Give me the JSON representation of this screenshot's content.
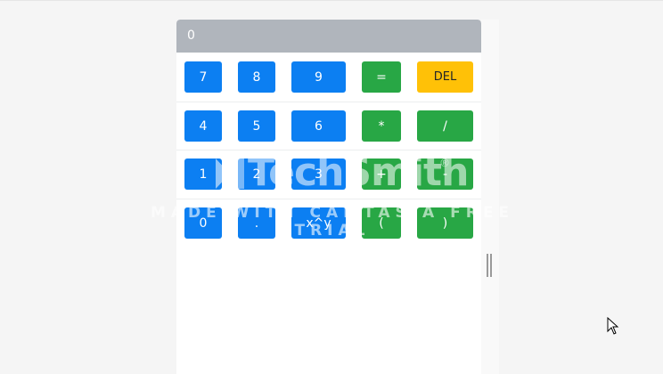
{
  "display": {
    "value": "0"
  },
  "keys": {
    "row1": [
      "7",
      "8",
      "9",
      "=",
      "DEL"
    ],
    "row2": [
      "4",
      "5",
      "6",
      "*",
      "/"
    ],
    "row3": [
      "1",
      "2",
      "3",
      "+",
      "-"
    ],
    "row4": [
      "0",
      ".",
      "x^y",
      "(",
      ")"
    ]
  },
  "watermark": {
    "brand": "TechSmith",
    "registered": "®",
    "tagline": "MADE WITH CAMTASIA FREE TRIAL"
  },
  "colors": {
    "digit": "#0c7ff2",
    "operator": "#28a745",
    "delete": "#ffc107",
    "display": "#b0b5bc"
  }
}
